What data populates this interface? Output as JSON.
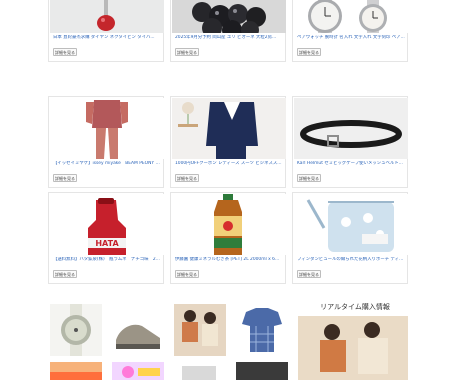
{
  "products": [
    {
      "title": "日本 直轮豪杰求購 ダイヤン ネクタイピン タイバ..."
    },
    {
      "title": "2025年9月分予約 岡山産 ユリ ピオーネ 大粒2房..."
    },
    {
      "title": "ペアウォッチ 腕時計 名入れ 文字入れ 文字刻印 ペア..."
    },
    {
      "title": "【イッセイミヤケ】issey miyake　BEAM PEONY B..."
    },
    {
      "title": "1000円OFFクーポン レディース スーツ ビジネスス..."
    },
    {
      "title": "Karl Helmut セミビッグケーブ使いメッシュベルト..."
    },
    {
      "title": "【送料無料】ハタ鉱泉(株)　瓶ラムネ　ナチゴ味　2..."
    },
    {
      "title": "伊藤園 健康ミネラルむぎ茶 [PET] 2L 2000ml x 6本..."
    },
    {
      "title": "フィンダンビュールの織られた花柄入りポーチ ディスナー..."
    }
  ],
  "detail_label": "詳細を見る",
  "realtime": {
    "title": "リアルタイム購入情報"
  }
}
